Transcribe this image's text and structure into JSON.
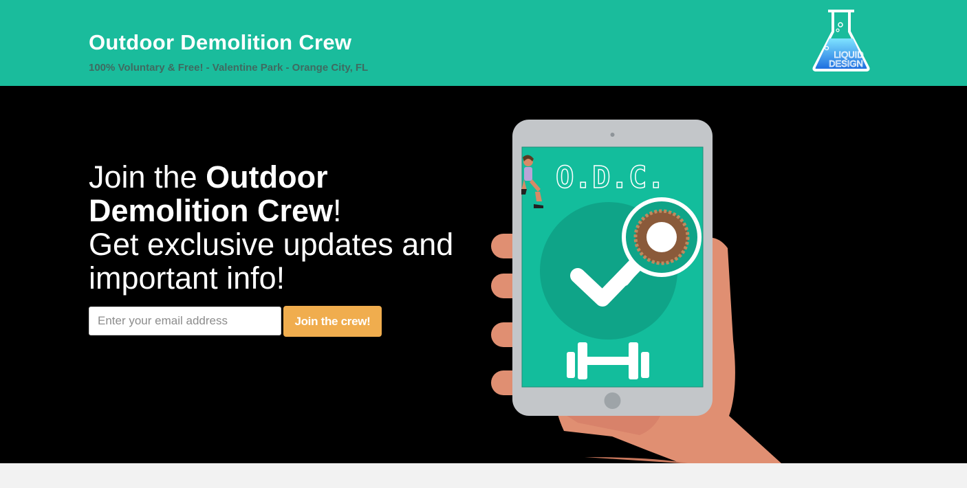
{
  "header": {
    "title": "Outdoor Demolition Crew",
    "subtitle": "100% Voluntary & Free! - Valentine Park - Orange City, FL",
    "logo": {
      "icon": "flask-logo",
      "text_line1": "LIQUID",
      "text_line2": "DESIGN"
    }
  },
  "hero": {
    "headline_part1": "Join the ",
    "headline_strong": "Outdoor Demolition Crew",
    "headline_part2": "!",
    "headline_part3": "Get exclusive updates and important info!",
    "email_placeholder": "Enter your email address",
    "email_value": "",
    "button_label": "Join the crew!"
  },
  "illustration": {
    "screen_title": "O.D.C.",
    "icons": [
      "runner-figure",
      "checkmark-icon",
      "magnifier-icon",
      "dumbbell-icon"
    ]
  },
  "colors": {
    "header_bg": "#1abc9c",
    "hero_bg": "#000000",
    "button": "#f0ad4e",
    "screen": "#13bd9c",
    "skin": "#e08f72"
  }
}
